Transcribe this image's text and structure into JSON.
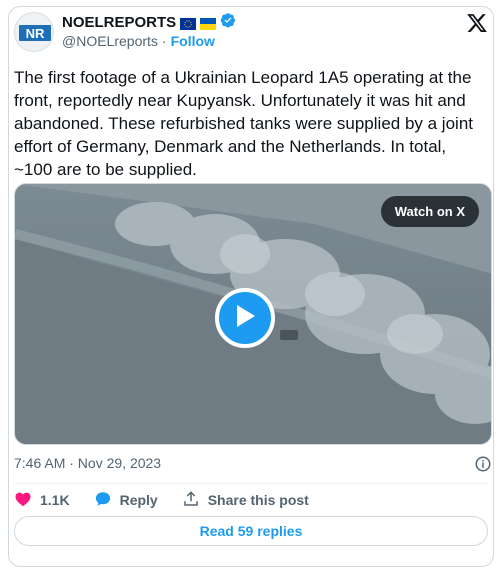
{
  "author": {
    "display_name": "NOELREPORTS",
    "handle": "@NOELreports",
    "separator": "·",
    "follow_label": "Follow",
    "avatar_text": "NR",
    "badges": [
      "eu-flag-icon",
      "ukraine-flag-icon",
      "verified-badge-icon"
    ]
  },
  "tweet": {
    "text": "The first footage of a Ukrainian Leopard 1A5 operating at the front, reportedly near Kupyansk. Unfortunately it was hit and abandoned. These refurbished tanks were supplied by a joint effort of Germany, Denmark and the Netherlands. In total, ~100 are to be supplied.",
    "timestamp": "7:46 AM · Nov 29, 2023"
  },
  "media": {
    "watch_label": "Watch on X",
    "play_icon": "play-icon"
  },
  "actions": {
    "likes": "1.1K",
    "reply_label": "Reply",
    "share_label": "Share this post"
  },
  "read_replies_label": "Read 59 replies",
  "colors": {
    "accent": "#1d9bf0",
    "like": "#f91880",
    "text": "#0f1419",
    "muted": "#536471",
    "border": "#cfd9de"
  }
}
